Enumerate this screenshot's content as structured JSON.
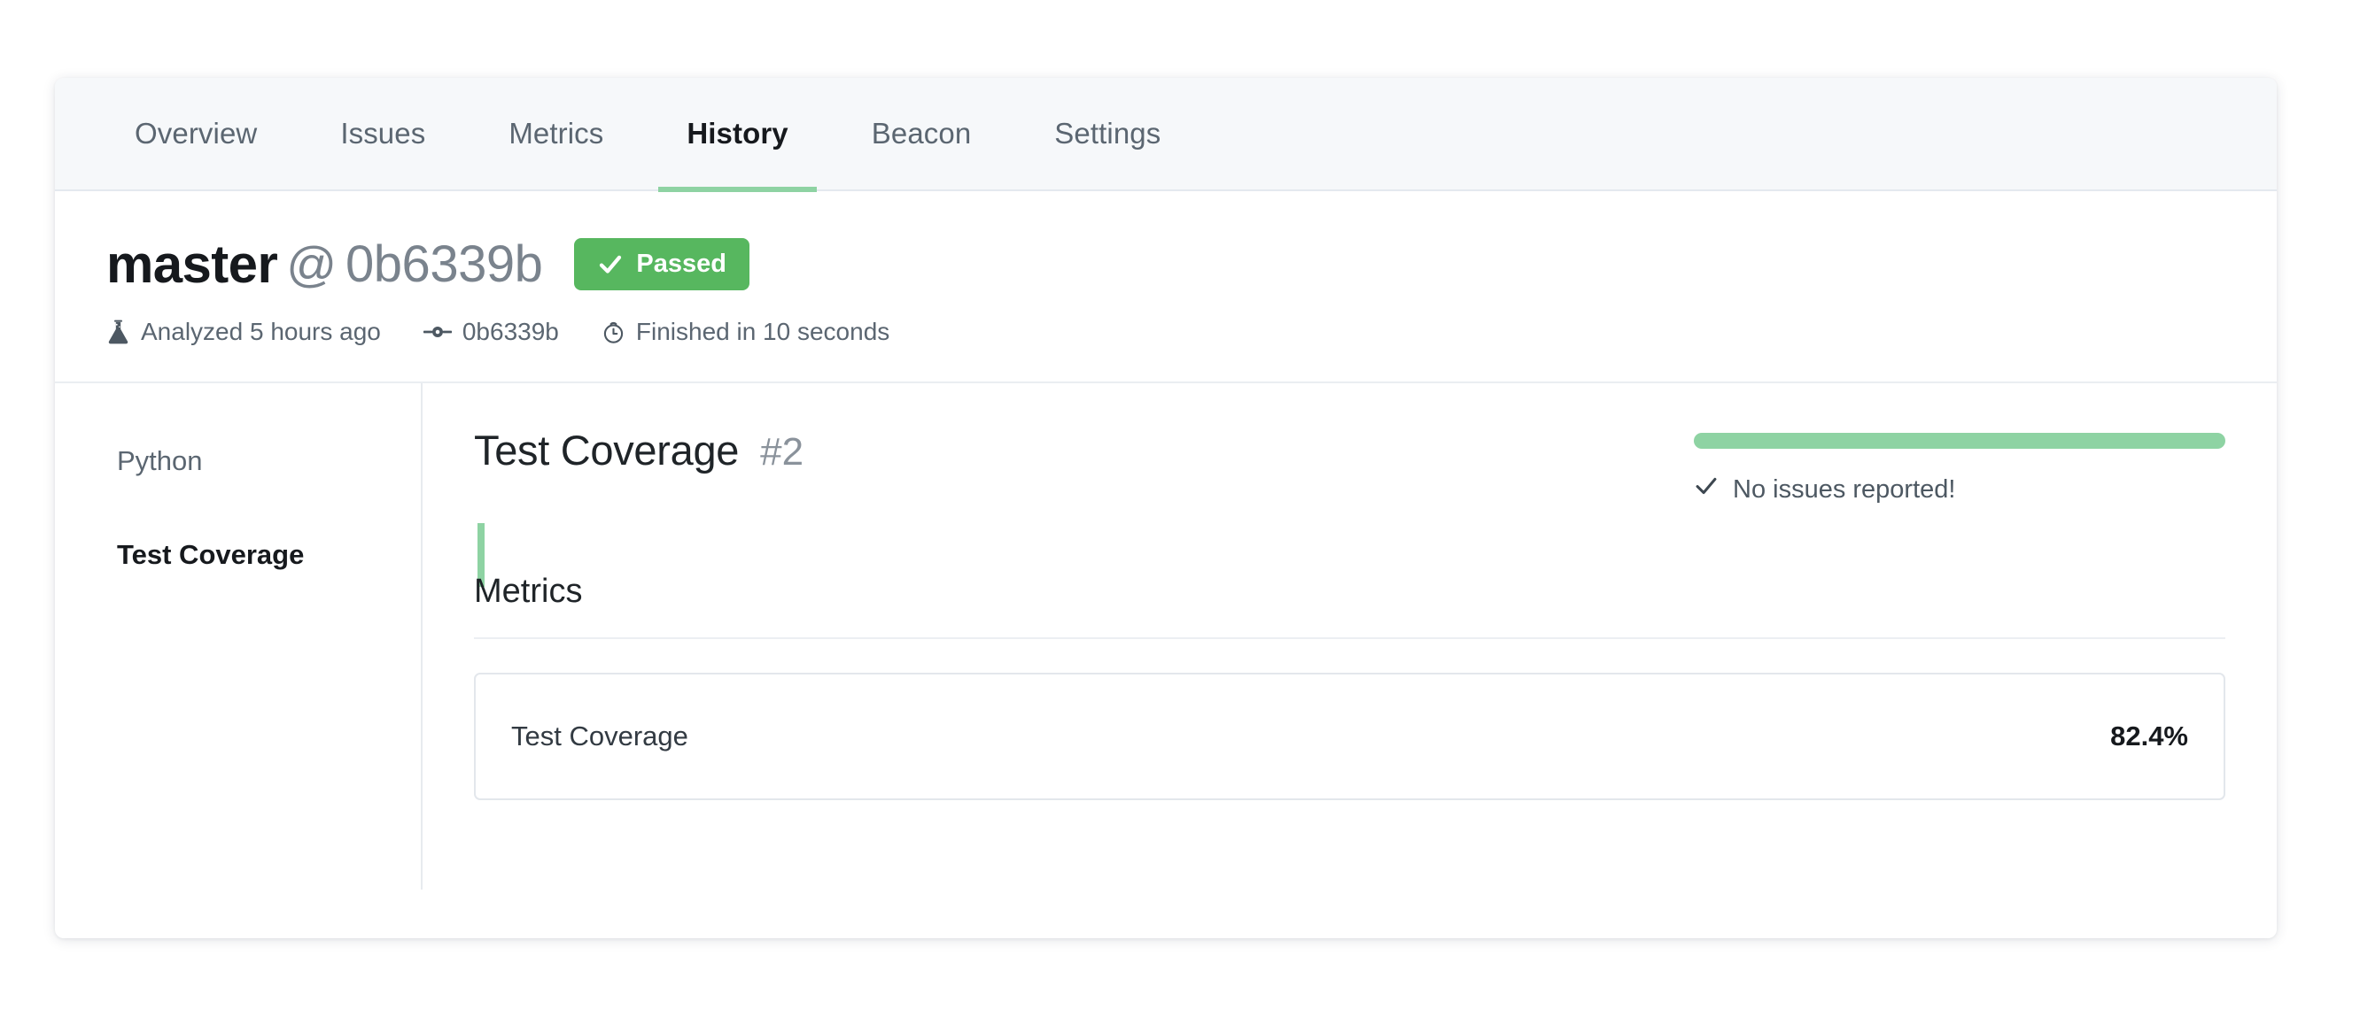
{
  "tabs": [
    {
      "label": "Overview",
      "active": false
    },
    {
      "label": "Issues",
      "active": false
    },
    {
      "label": "Metrics",
      "active": false
    },
    {
      "label": "History",
      "active": true
    },
    {
      "label": "Beacon",
      "active": false
    },
    {
      "label": "Settings",
      "active": false
    }
  ],
  "header": {
    "branch": "master",
    "separator": "@",
    "commit_sha": "0b6339b",
    "status_badge": {
      "label": "Passed",
      "icon": "check-icon",
      "color": "#57b75f"
    },
    "meta": [
      {
        "icon": "flask-icon",
        "text": "Analyzed 5 hours ago"
      },
      {
        "icon": "git-commit-icon",
        "text": "0b6339b"
      },
      {
        "icon": "stopwatch-icon",
        "text": "Finished in 10 seconds"
      }
    ]
  },
  "sidebar": {
    "items": [
      {
        "label": "Python",
        "active": false
      },
      {
        "label": "Test Coverage",
        "active": true
      }
    ],
    "active_indicator_color": "#8ed3a3"
  },
  "content": {
    "title": "Test Coverage",
    "number": "#2",
    "progress": {
      "percent": 100,
      "color": "#8ed3a3"
    },
    "no_issues_text": "No issues reported!",
    "no_issues_icon": "check-icon",
    "metrics_heading": "Metrics",
    "metrics": [
      {
        "label": "Test Coverage",
        "value": "82.4%"
      }
    ]
  }
}
